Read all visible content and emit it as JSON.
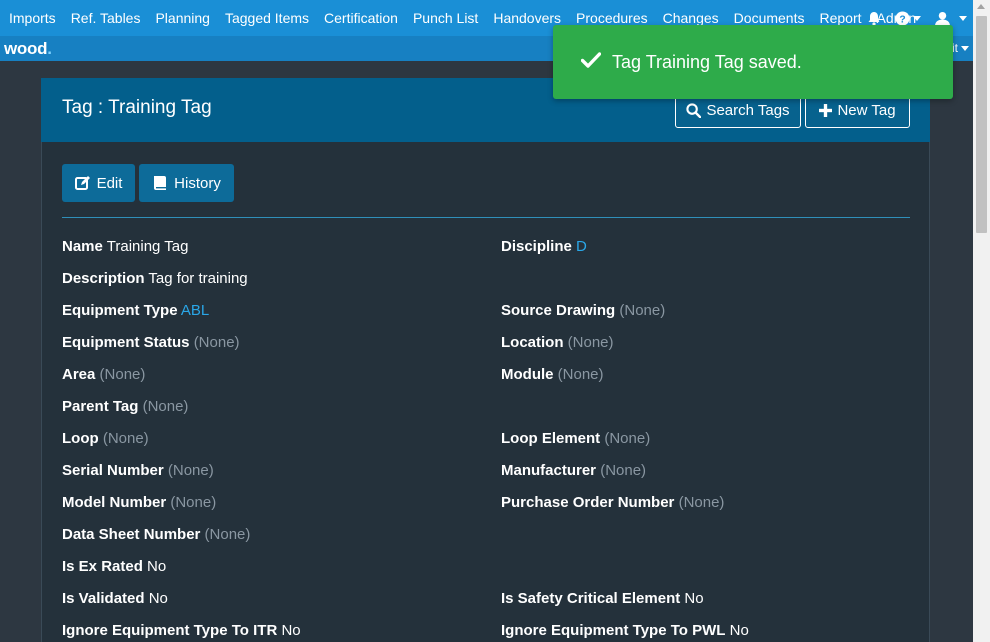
{
  "nav": {
    "items": [
      "Imports",
      "Ref. Tables",
      "Planning",
      "Tagged Items",
      "Certification",
      "Punch List",
      "Handovers",
      "Procedures",
      "Changes",
      "Documents",
      "Report",
      "Admin"
    ]
  },
  "brand": {
    "logo_text": "wood",
    "logo_dot": "."
  },
  "subbar": {
    "right_text": "it"
  },
  "toast": {
    "message": "Tag Training Tag saved.",
    "color": "#2eab4a"
  },
  "header": {
    "title": "Tag : Training Tag",
    "search_label": "Search Tags",
    "new_label": "New Tag"
  },
  "actions": {
    "edit_label": "Edit",
    "history_label": "History"
  },
  "fields": {
    "name": {
      "label": "Name",
      "value": "Training Tag"
    },
    "discipline": {
      "label": "Discipline",
      "value": "D"
    },
    "description": {
      "label": "Description",
      "value": "Tag for training"
    },
    "equipment_type": {
      "label": "Equipment Type",
      "value": "ABL"
    },
    "source_drawing": {
      "label": "Source Drawing",
      "value": "(None)"
    },
    "equipment_status": {
      "label": "Equipment Status",
      "value": "(None)"
    },
    "location": {
      "label": "Location",
      "value": "(None)"
    },
    "area": {
      "label": "Area",
      "value": "(None)"
    },
    "module": {
      "label": "Module",
      "value": "(None)"
    },
    "parent_tag": {
      "label": "Parent Tag",
      "value": "(None)"
    },
    "loop": {
      "label": "Loop",
      "value": "(None)"
    },
    "loop_element": {
      "label": "Loop Element",
      "value": "(None)"
    },
    "serial_number": {
      "label": "Serial Number",
      "value": "(None)"
    },
    "manufacturer": {
      "label": "Manufacturer",
      "value": "(None)"
    },
    "model_number": {
      "label": "Model Number",
      "value": "(None)"
    },
    "purchase_order_number": {
      "label": "Purchase Order Number",
      "value": "(None)"
    },
    "data_sheet_number": {
      "label": "Data Sheet Number",
      "value": "(None)"
    },
    "is_ex_rated": {
      "label": "Is Ex Rated",
      "value": "No"
    },
    "is_validated": {
      "label": "Is Validated",
      "value": "No"
    },
    "is_safety_critical": {
      "label": "Is Safety Critical Element",
      "value": "No"
    },
    "ignore_itr": {
      "label": "Ignore Equipment Type To ITR",
      "value": "No"
    },
    "ignore_pwl": {
      "label": "Ignore Equipment Type To PWL",
      "value": "No"
    }
  }
}
